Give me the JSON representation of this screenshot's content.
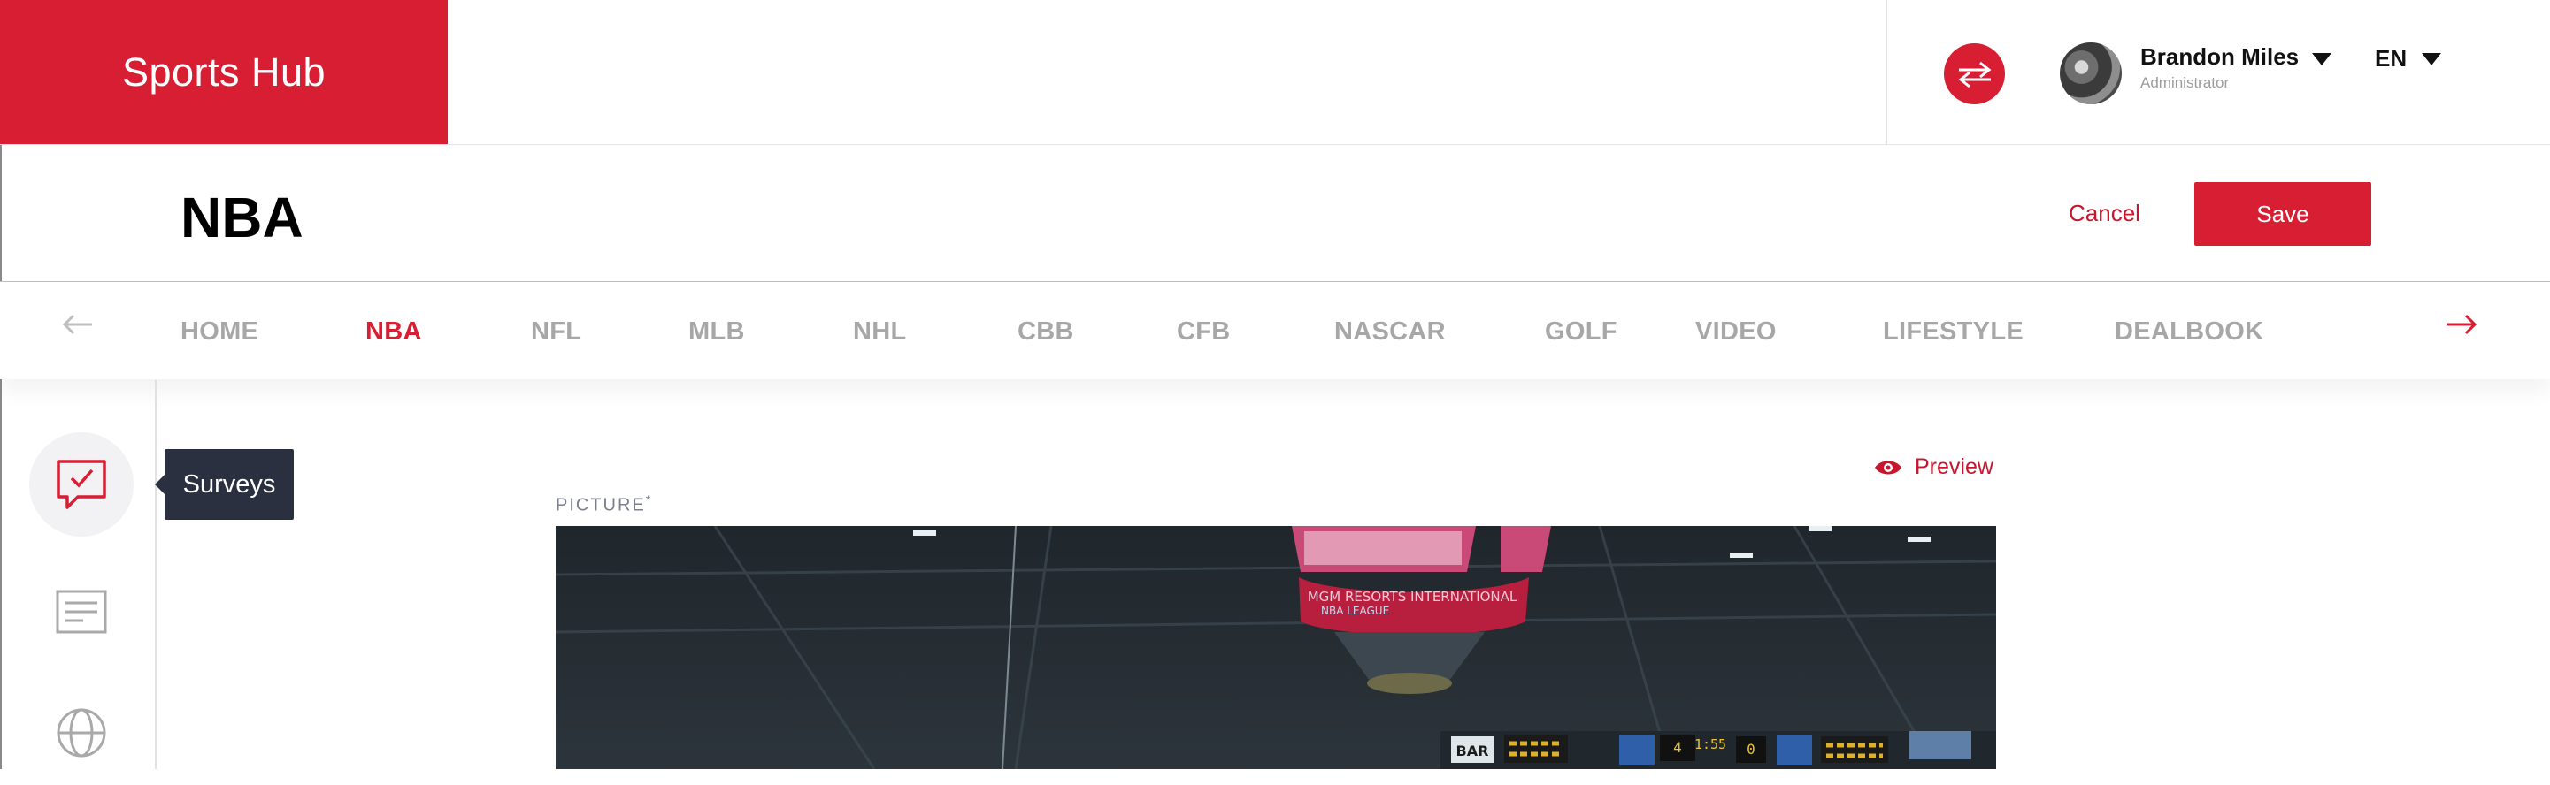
{
  "header": {
    "brand": "Sports Hub",
    "user": {
      "name": "Brandon Miles",
      "role": "Administrator"
    },
    "language": "EN"
  },
  "page": {
    "title": "NBA",
    "cancel_label": "Cancel",
    "save_label": "Save"
  },
  "tabs": [
    {
      "label": "HOME"
    },
    {
      "label": "NBA"
    },
    {
      "label": "NFL"
    },
    {
      "label": "MLB"
    },
    {
      "label": "NHL"
    },
    {
      "label": "CBB"
    },
    {
      "label": "CFB"
    },
    {
      "label": "NASCAR"
    },
    {
      "label": "GOLF"
    },
    {
      "label": "VIDEO"
    },
    {
      "label": "LIFESTYLE"
    },
    {
      "label": "DEALBOOK"
    }
  ],
  "active_tab": "NBA",
  "sidebar": {
    "tooltip": "Surveys",
    "icons": [
      "survey-icon",
      "article-icon",
      "globe-icon"
    ]
  },
  "content": {
    "preview_label": "Preview",
    "picture_label": "PICTURE",
    "required_mark": "*",
    "picture_scene": {
      "sign_texts": [
        "MGM RESORTS INTERNATIONAL",
        "NBA LEAGUE",
        "BAR"
      ],
      "scoreboard_numbers": [
        "4",
        "1:55",
        "0"
      ]
    }
  },
  "colors": {
    "accent": "#d71e33",
    "tab_inactive": "#a7a7a7",
    "tooltip_bg": "#2b3040"
  }
}
